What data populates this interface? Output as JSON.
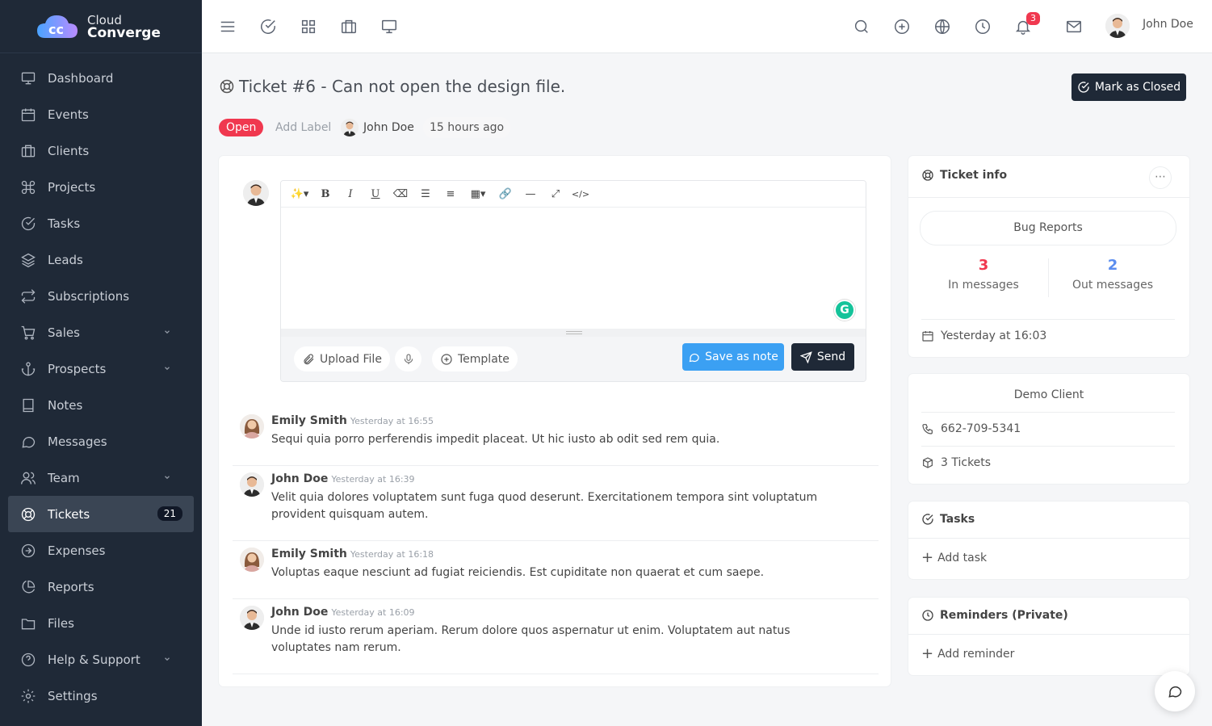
{
  "brand": {
    "line1": "Cloud",
    "line2": "Converge"
  },
  "sidebar": {
    "items": [
      {
        "label": "Dashboard",
        "icon": "monitor-icon"
      },
      {
        "label": "Events",
        "icon": "calendar-icon"
      },
      {
        "label": "Clients",
        "icon": "briefcase-icon"
      },
      {
        "label": "Projects",
        "icon": "command-icon"
      },
      {
        "label": "Tasks",
        "icon": "check-circle-icon"
      },
      {
        "label": "Leads",
        "icon": "layers-icon"
      },
      {
        "label": "Subscriptions",
        "icon": "repeat-icon"
      },
      {
        "label": "Sales",
        "icon": "cart-icon"
      },
      {
        "label": "Prospects",
        "icon": "anchor-icon"
      },
      {
        "label": "Notes",
        "icon": "book-icon"
      },
      {
        "label": "Messages",
        "icon": "message-circle-icon"
      },
      {
        "label": "Team",
        "icon": "users-icon"
      },
      {
        "label": "Tickets",
        "icon": "life-buoy-icon",
        "count": "21"
      },
      {
        "label": "Expenses",
        "icon": "arrow-right-circle-icon"
      },
      {
        "label": "Reports",
        "icon": "pie-chart-icon"
      },
      {
        "label": "Files",
        "icon": "folder-icon"
      },
      {
        "label": "Help & Support",
        "icon": "help-circle-icon"
      },
      {
        "label": "Settings",
        "icon": "settings-icon"
      }
    ]
  },
  "topbar": {
    "notification_count": "3",
    "user_name": "John Doe"
  },
  "ticket": {
    "title": "Ticket #6 - Can not open the design file.",
    "mark_closed_label": "Mark as Closed",
    "status": "Open",
    "add_label": "Add Label",
    "assignee": "John Doe",
    "created": "15 hours ago"
  },
  "editor": {
    "upload_label": "Upload File",
    "template_label": "Template",
    "save_note_label": "Save as note",
    "send_label": "Send"
  },
  "messages": [
    {
      "author": "Emily Smith",
      "time": "Yesterday at 16:55",
      "body": "Sequi quia porro perferendis impedit placeat. Ut hic iusto ab odit sed rem quia.",
      "avatar": "female"
    },
    {
      "author": "John Doe",
      "time": "Yesterday at 16:39",
      "body": "Velit quia dolores voluptatem sunt fuga quod deserunt. Exercitationem tempora sint voluptatum provident quisquam autem.",
      "avatar": "male"
    },
    {
      "author": "Emily Smith",
      "time": "Yesterday at 16:18",
      "body": "Voluptas eaque nesciunt ad fugiat reiciendis. Est cupiditate non quaerat et cum saepe.",
      "avatar": "female"
    },
    {
      "author": "John Doe",
      "time": "Yesterday at 16:09",
      "body": "Unde id iusto rerum aperiam. Rerum dolore quos aspernatur ut enim. Voluptatem aut natus voluptates nam rerum.",
      "avatar": "male"
    }
  ],
  "ticket_info": {
    "title": "Ticket info",
    "type": "Bug Reports",
    "in_count": "3",
    "in_label": "In messages",
    "out_count": "2",
    "out_label": "Out messages",
    "date": "Yesterday at 16:03"
  },
  "client": {
    "name": "Demo Client",
    "phone": "662-709-5341",
    "tickets": "3 Tickets"
  },
  "tasks": {
    "title": "Tasks",
    "add_label": "Add task"
  },
  "reminders": {
    "title": "Reminders (Private)",
    "add_label": "Add reminder"
  },
  "colors": {
    "sidebar_bg": "#1f2937",
    "accent_red": "#f0384f",
    "accent_blue": "#3ba0f3",
    "out_blue": "#5b8def"
  }
}
